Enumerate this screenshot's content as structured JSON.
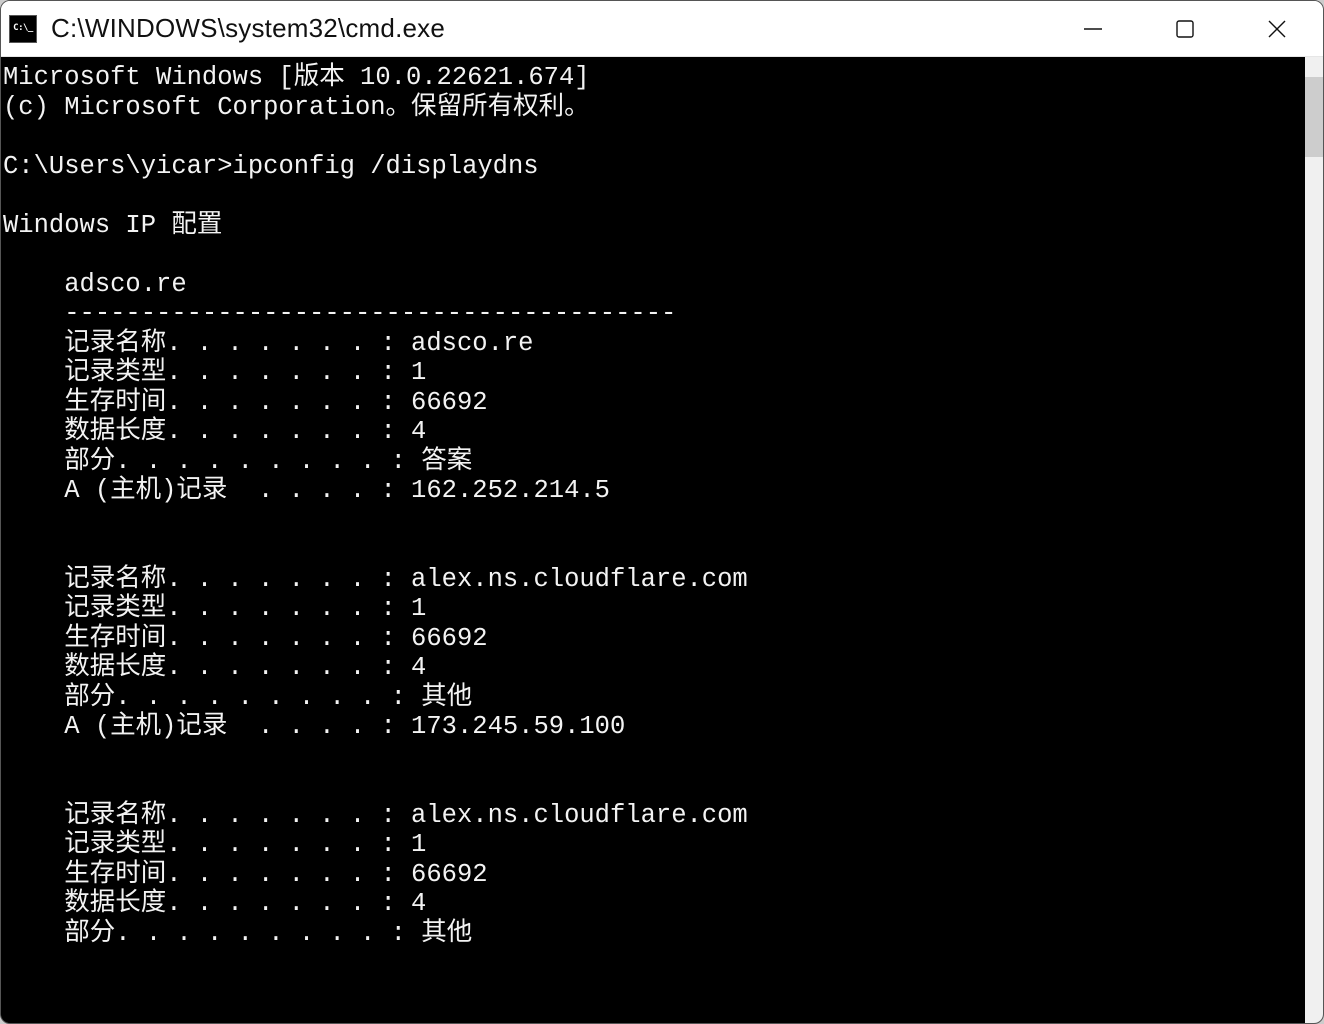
{
  "window": {
    "title": "C:\\WINDOWS\\system32\\cmd.exe"
  },
  "terminal": {
    "banner_line1": "Microsoft Windows [版本 10.0.22621.674]",
    "banner_line2": "(c) Microsoft Corporation。保留所有权利。",
    "prompt": "C:\\Users\\yicar>",
    "command": "ipconfig /displaydns",
    "section_header": "Windows IP 配置",
    "indent": "    ",
    "domain_header": "adsco.re",
    "separator": "----------------------------------------",
    "labels": {
      "record_name": "记录名称. . . . . . . :",
      "record_type": "记录类型. . . . . . . :",
      "ttl": "生存时间. . . . . . . :",
      "data_length": "数据长度. . . . . . . :",
      "section": "部分. . . . . . . . . :",
      "a_record": "A (主机)记录  . . . . :"
    },
    "records": [
      {
        "name": "adsco.re",
        "type": "1",
        "ttl": "66692",
        "data_length": "4",
        "section": "答案",
        "a_host": "162.252.214.5"
      },
      {
        "name": "alex.ns.cloudflare.com",
        "type": "1",
        "ttl": "66692",
        "data_length": "4",
        "section": "其他",
        "a_host": "173.245.59.100"
      },
      {
        "name": "alex.ns.cloudflare.com",
        "type": "1",
        "ttl": "66692",
        "data_length": "4",
        "section": "其他"
      }
    ]
  }
}
